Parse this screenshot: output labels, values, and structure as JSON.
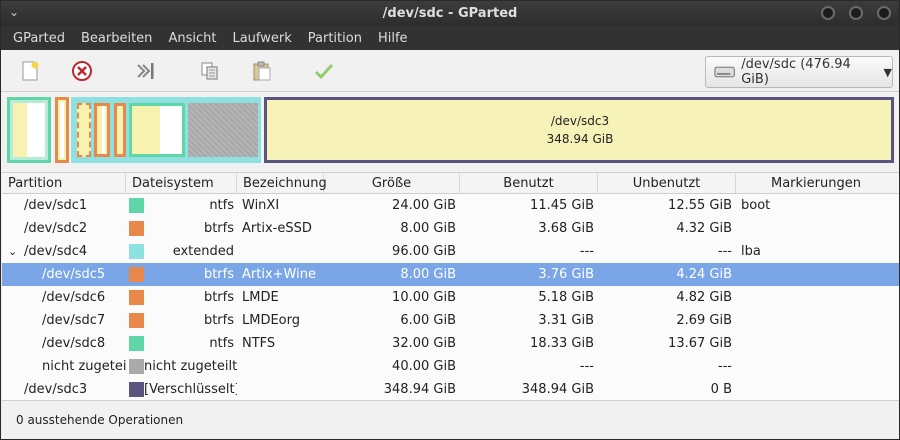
{
  "window": {
    "title": "/dev/sdc - GParted"
  },
  "menubar": {
    "items": [
      "GParted",
      "Bearbeiten",
      "Ansicht",
      "Laufwerk",
      "Partition",
      "Hilfe"
    ]
  },
  "toolbar": {
    "device_label": "/dev/sdc (476.94 GiB)"
  },
  "diskmap": {
    "sdc3_name": "/dev/sdc3",
    "sdc3_size": "348.94 GiB"
  },
  "table": {
    "headers": [
      "Partition",
      "Dateisystem",
      "Bezeichnung",
      "Größe",
      "Benutzt",
      "Unbenutzt",
      "Markierungen"
    ],
    "rows": [
      {
        "partition": "/dev/sdc1",
        "fs": "ntfs",
        "fs_color": "#5fd6a8",
        "label": "WinXI",
        "size": "24.00 GiB",
        "used": "11.45 GiB",
        "unused": "12.55 GiB",
        "flags": "boot",
        "indent": 0
      },
      {
        "partition": "/dev/sdc2",
        "fs": "btrfs",
        "fs_color": "#e8884a",
        "label": "Artix-eSSD",
        "size": "8.00 GiB",
        "used": "3.68 GiB",
        "unused": "4.32 GiB",
        "flags": "",
        "indent": 0
      },
      {
        "partition": "/dev/sdc4",
        "fs": "extended",
        "fs_color": "#8fe0e0",
        "label": "",
        "size": "96.00 GiB",
        "used": "---",
        "unused": "---",
        "flags": "lba",
        "indent": 0,
        "expander": "⌄"
      },
      {
        "partition": "/dev/sdc5",
        "fs": "btrfs",
        "fs_color": "#e8884a",
        "label": "Artix+Wine",
        "size": "8.00 GiB",
        "used": "3.76 GiB",
        "unused": "4.24 GiB",
        "flags": "",
        "indent": 1,
        "selected": true
      },
      {
        "partition": "/dev/sdc6",
        "fs": "btrfs",
        "fs_color": "#e8884a",
        "label": "LMDE",
        "size": "10.00 GiB",
        "used": "5.18 GiB",
        "unused": "4.82 GiB",
        "flags": "",
        "indent": 1
      },
      {
        "partition": "/dev/sdc7",
        "fs": "btrfs",
        "fs_color": "#e8884a",
        "label": "LMDEorg",
        "size": "6.00 GiB",
        "used": "3.31 GiB",
        "unused": "2.69 GiB",
        "flags": "",
        "indent": 1
      },
      {
        "partition": "/dev/sdc8",
        "fs": "ntfs",
        "fs_color": "#5fd6a8",
        "label": "NTFS",
        "size": "32.00 GiB",
        "used": "18.33 GiB",
        "unused": "13.67 GiB",
        "flags": "",
        "indent": 1
      },
      {
        "partition": "nicht zugeteilt",
        "fs": "nicht zugeteilt",
        "fs_color": "#aaaaaa",
        "label": "",
        "size": "40.00 GiB",
        "used": "---",
        "unused": "---",
        "flags": "",
        "indent": 1
      },
      {
        "partition": "/dev/sdc3",
        "fs": "[Verschlüsselt]",
        "fs_color": "#5a5580",
        "label": "",
        "size": "348.94 GiB",
        "used": "348.94 GiB",
        "unused": "0 B",
        "flags": "",
        "indent": 0
      }
    ]
  },
  "status": {
    "text": "0 ausstehende Operationen"
  },
  "icons": [
    "new-icon",
    "delete-icon",
    "resize-icon",
    "copy-icon",
    "paste-icon",
    "apply-icon",
    "disk-icon",
    "chevron-down-icon"
  ]
}
